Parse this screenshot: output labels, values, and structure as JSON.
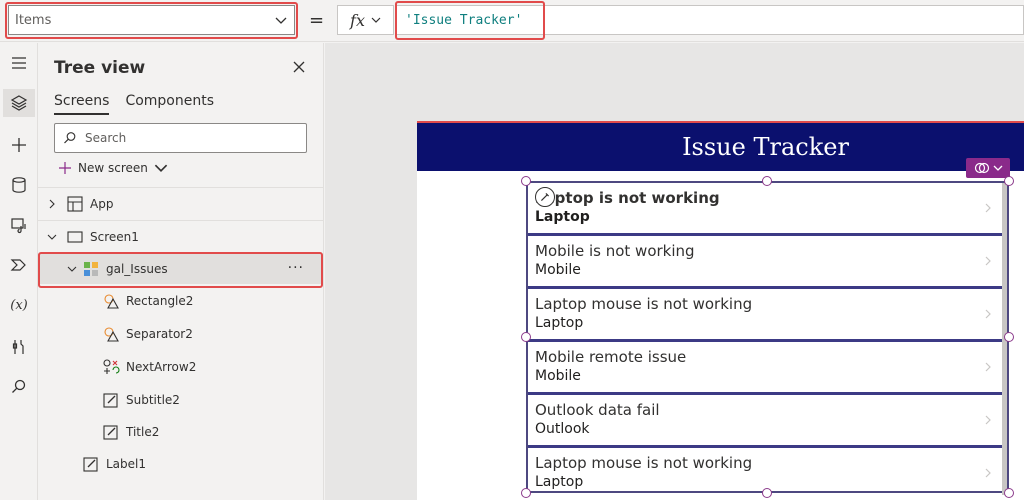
{
  "formula_bar": {
    "property": "Items",
    "equals": "=",
    "fx_label": "fx",
    "formula": "'Issue Tracker'"
  },
  "rail": {
    "icons": [
      "menu-icon",
      "layers-icon",
      "plus-icon",
      "database-icon",
      "media-icon",
      "power-automate-icon",
      "variables-icon",
      "tools-icon",
      "search-icon"
    ],
    "variables_label": "(x)"
  },
  "tree_view": {
    "title": "Tree view",
    "tabs": [
      {
        "label": "Screens",
        "selected": true
      },
      {
        "label": "Components",
        "selected": false
      }
    ],
    "search_placeholder": "Search",
    "new_screen_label": "New screen",
    "nodes": {
      "app": "App",
      "screen1": "Screen1",
      "gallery": "gal_Issues",
      "more": "···",
      "rectangle": "Rectangle2",
      "separator": "Separator2",
      "next_arrow": "NextArrow2",
      "subtitle": "Subtitle2",
      "title": "Title2",
      "label": "Label1"
    }
  },
  "canvas": {
    "header_title": "Issue Tracker",
    "gallery_items": [
      {
        "title": "Laptop is not working",
        "subtitle": "Laptop"
      },
      {
        "title": "Mobile is not working",
        "subtitle": "Mobile"
      },
      {
        "title": "Laptop mouse is not working",
        "subtitle": "Laptop"
      },
      {
        "title": "Mobile remote issue",
        "subtitle": "Mobile"
      },
      {
        "title": "Outlook data fail",
        "subtitle": "Outlook"
      },
      {
        "title": "Laptop mouse is not working",
        "subtitle": "Laptop"
      }
    ]
  },
  "colors": {
    "header_bg": "#0b106e",
    "highlight_red": "#e14b4b",
    "formula_text": "#0f7f7f",
    "gallery_border": "#3c3a85",
    "badge": "#8a2a8a"
  }
}
